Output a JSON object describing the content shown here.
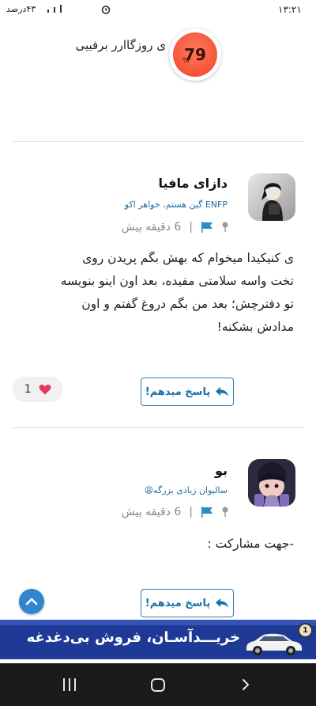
{
  "status_bar": {
    "time": "۱۳:۲۱",
    "battery": "۴۳درصد"
  },
  "top_item": {
    "score": "79",
    "percent_sign": "%",
    "text": "ی روزگاارر برفییی"
  },
  "comments": [
    {
      "username": "دازای مافیا",
      "tagline": "ENFP گین هستم، خواهر اکو",
      "time": "6 دقیقه پیش",
      "separator": "|",
      "body": "ی کنیکیدا میخوام که بهش بگم پریدن روی تخت واسه سلامتی مفیده، بعد اون اینو بنویسه تو دفترچش؛ بعد من بگم دروغ گفتم و اون مدادش بشکنه!",
      "reply_label": "پاسخ میدهم!",
      "likes": "1"
    },
    {
      "username": "بو",
      "tagline": "سالیوان زیادی بزرگه😩",
      "time": "6 دقیقه پیش",
      "separator": "|",
      "body": "-جهت مشارکت :",
      "reply_label": "پاسخ میدهم!"
    }
  ],
  "ad_banner": {
    "text": "خریـــدآسـان، فروش بی‌دغدغه",
    "logo_text": "1"
  },
  "colors": {
    "accent": "#2e7fb8",
    "score_red": "#f0432c",
    "ad_blue": "#1f3a96"
  }
}
